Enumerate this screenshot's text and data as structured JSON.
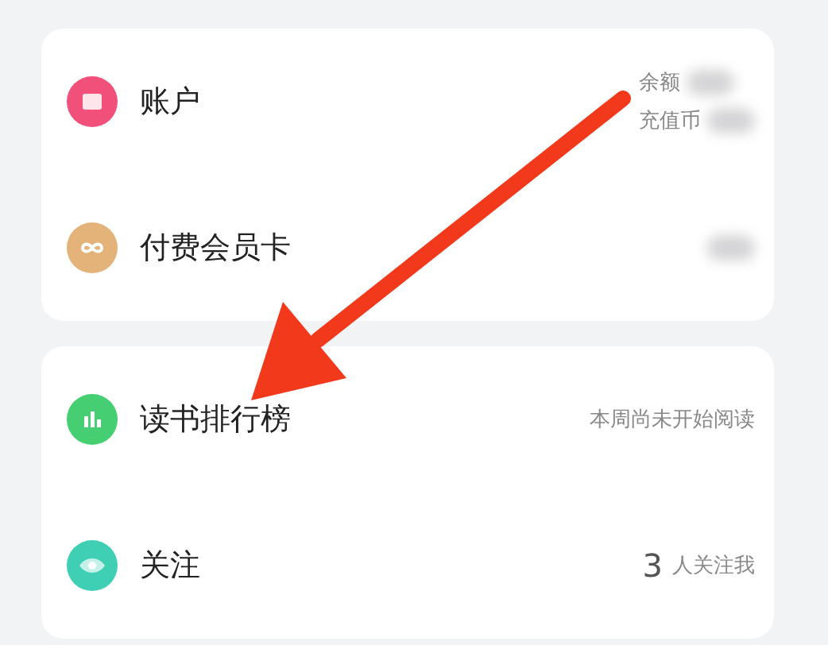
{
  "cards": [
    {
      "rows": [
        {
          "kind": "account",
          "label": "账户",
          "color": "#f0507a",
          "details": [
            {
              "text": "余额",
              "blurred": true
            },
            {
              "text": "充值币",
              "blurred": true
            }
          ]
        },
        {
          "kind": "membership",
          "label": "付费会员卡",
          "color": "#e4b37a",
          "details": [
            {
              "blurred": true
            }
          ]
        }
      ]
    },
    {
      "rows": [
        {
          "kind": "ranking",
          "label": "读书排行榜",
          "color": "#45cf72",
          "details": [
            {
              "text": "本周尚未开始阅读"
            }
          ]
        },
        {
          "kind": "follow",
          "label": "关注",
          "color": "#3fcfb4",
          "count": "3",
          "details": [
            {
              "text": "人关注我"
            }
          ]
        }
      ]
    }
  ],
  "annotation": {
    "kind": "arrow",
    "color": "#f2391c"
  }
}
